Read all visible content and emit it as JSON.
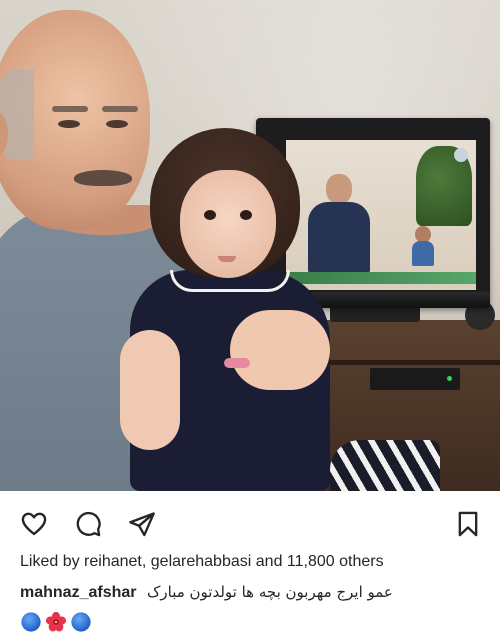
{
  "post": {
    "photo_alt": "Photo",
    "actions": {
      "like_icon": "heart-outline-icon",
      "comment_icon": "comment-bubble-icon",
      "share_icon": "paper-plane-icon",
      "save_icon": "bookmark-outline-icon"
    },
    "likes": {
      "prefix": "Liked by",
      "users": [
        "reihanet",
        "gelarehabbasi"
      ],
      "separator": ",",
      "conjunction": "and",
      "count_text": "11,800 others"
    },
    "caption": {
      "username": "mahnaz_afshar",
      "text": "عمو ایرج مهربون بچه ها تولدتون مبارک",
      "emojis": [
        "blue-circle-emoji",
        "hibiscus-flower-emoji",
        "blue-circle-emoji"
      ]
    }
  },
  "colors": {
    "text": "#262626",
    "background": "#ffffff",
    "emoji_blue": "#1e6fd9",
    "emoji_hibiscus": "#e8334a"
  }
}
